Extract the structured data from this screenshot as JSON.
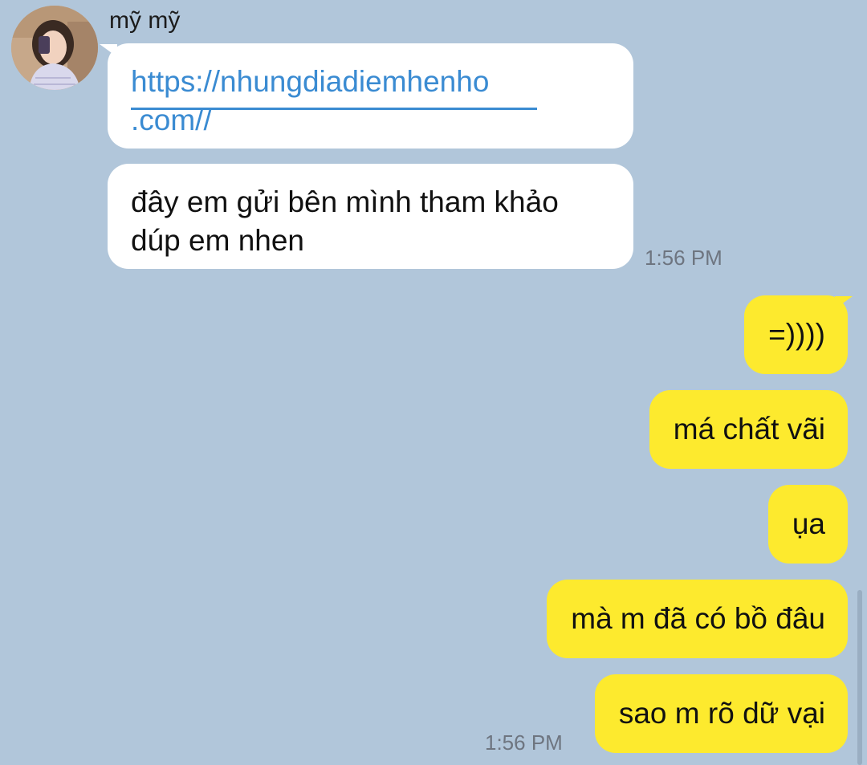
{
  "chat": {
    "sender_name": "mỹ mỹ",
    "incoming": [
      {
        "link_text": "https://nhungdiadiemhenho.com//",
        "link_line1": "https://nhungdiadiemhenho",
        "link_line2": ".com//"
      },
      {
        "line1": "đây em gửi bên mình tham khảo",
        "line2": "dúp em nhen"
      }
    ],
    "incoming_time": "1:56 PM",
    "outgoing": [
      {
        "text": "=))))"
      },
      {
        "text": "má chất vãi"
      },
      {
        "text": "ụa"
      },
      {
        "text": "mà m đã có bồ đâu"
      },
      {
        "text": "sao m rõ dữ vại"
      }
    ],
    "outgoing_time": "1:56 PM"
  },
  "colors": {
    "background": "#b1c6da",
    "incoming_bubble": "#ffffff",
    "outgoing_bubble": "#fdea2e",
    "link": "#3a8bd2",
    "timestamp": "#6e7580"
  }
}
